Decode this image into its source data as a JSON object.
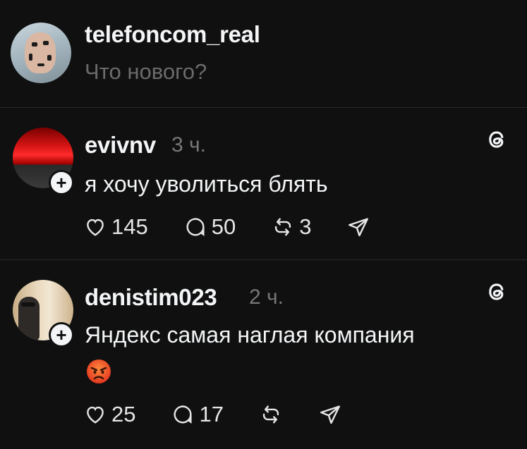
{
  "composer": {
    "username": "telefoncom_real",
    "prompt": "Что нового?"
  },
  "posts": [
    {
      "username": "evivnv",
      "time": "3 ч.",
      "text": "я хочу уволиться блять",
      "likes": "145",
      "replies": "50",
      "reposts": "3"
    },
    {
      "username": "denistim023",
      "time": "2 ч.",
      "text": "Яндекс самая наглая компания",
      "emoji": "angry-face",
      "likes": "25",
      "replies": "17",
      "reposts": ""
    }
  ],
  "icons": {
    "follow": "plus-icon",
    "like": "heart-icon",
    "reply": "comment-icon",
    "repost": "repost-icon",
    "share": "send-icon",
    "app": "threads-icon"
  },
  "colors": {
    "background": "#101010",
    "text": "#f3f5f7",
    "muted": "#777777",
    "divider": "#2a2a2a"
  }
}
